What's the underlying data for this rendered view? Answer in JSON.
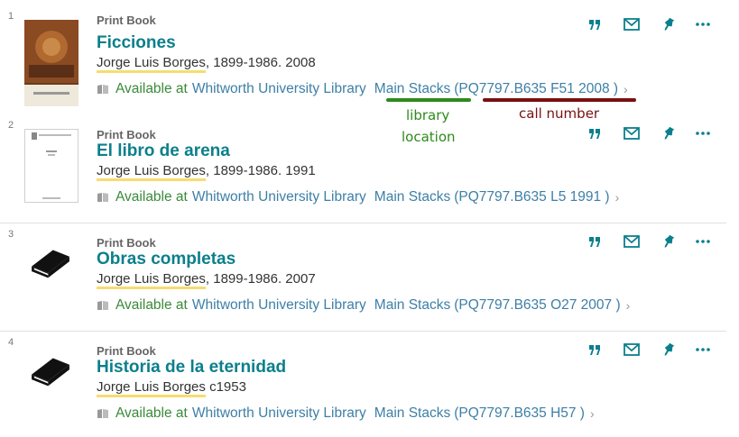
{
  "results": [
    {
      "index": "1",
      "type": "Print Book",
      "title": "Ficciones",
      "author_name": "Jorge Luis Borges",
      "author_rest": ", 1899-1986. 2008",
      "status": "Available at",
      "library": "Whitworth University Library",
      "location": "Main Stacks",
      "call": "(PQ7797.B635 F51 2008 )",
      "chevron": "›"
    },
    {
      "index": "2",
      "type": "Print Book",
      "title": "El libro de arena",
      "author_name": "Jorge Luis Borges",
      "author_rest": ", 1899-1986. 1991",
      "status": "Available at",
      "library": "Whitworth University Library",
      "location": "Main Stacks",
      "call": "(PQ7797.B635 L5 1991 )",
      "chevron": "›"
    },
    {
      "index": "3",
      "type": "Print Book",
      "title": "Obras completas",
      "author_name": "Jorge Luis Borges",
      "author_rest": ", 1899-1986. 2007",
      "status": "Available at",
      "library": "Whitworth University Library",
      "location": "Main Stacks",
      "call": "(PQ7797.B635 O27 2007 )",
      "chevron": "›"
    },
    {
      "index": "4",
      "type": "Print Book",
      "title": "Historia de la eternidad",
      "author_name": "Jorge Luis Borges",
      "author_rest": " c1953",
      "status": "Available at",
      "library": "Whitworth University Library",
      "location": "Main Stacks",
      "call": "(PQ7797.B635 H57 )",
      "chevron": "›"
    }
  ],
  "annotations": {
    "library_location_line1": "library",
    "library_location_line2": "location",
    "call_number": "call number"
  },
  "icons": {
    "cite": "quote-icon",
    "email": "mail-icon",
    "pin": "pin-icon",
    "more": "more-icon",
    "availability": "book-availability-icon"
  },
  "colors": {
    "title": "#0b7f8c",
    "available": "#3a8a3a",
    "link": "#3d7fa6",
    "author_highlight": "#f7dc6f",
    "annotation_green": "#2d8a1c",
    "annotation_red": "#7a1010",
    "action_icons": "#0b7f8c"
  }
}
